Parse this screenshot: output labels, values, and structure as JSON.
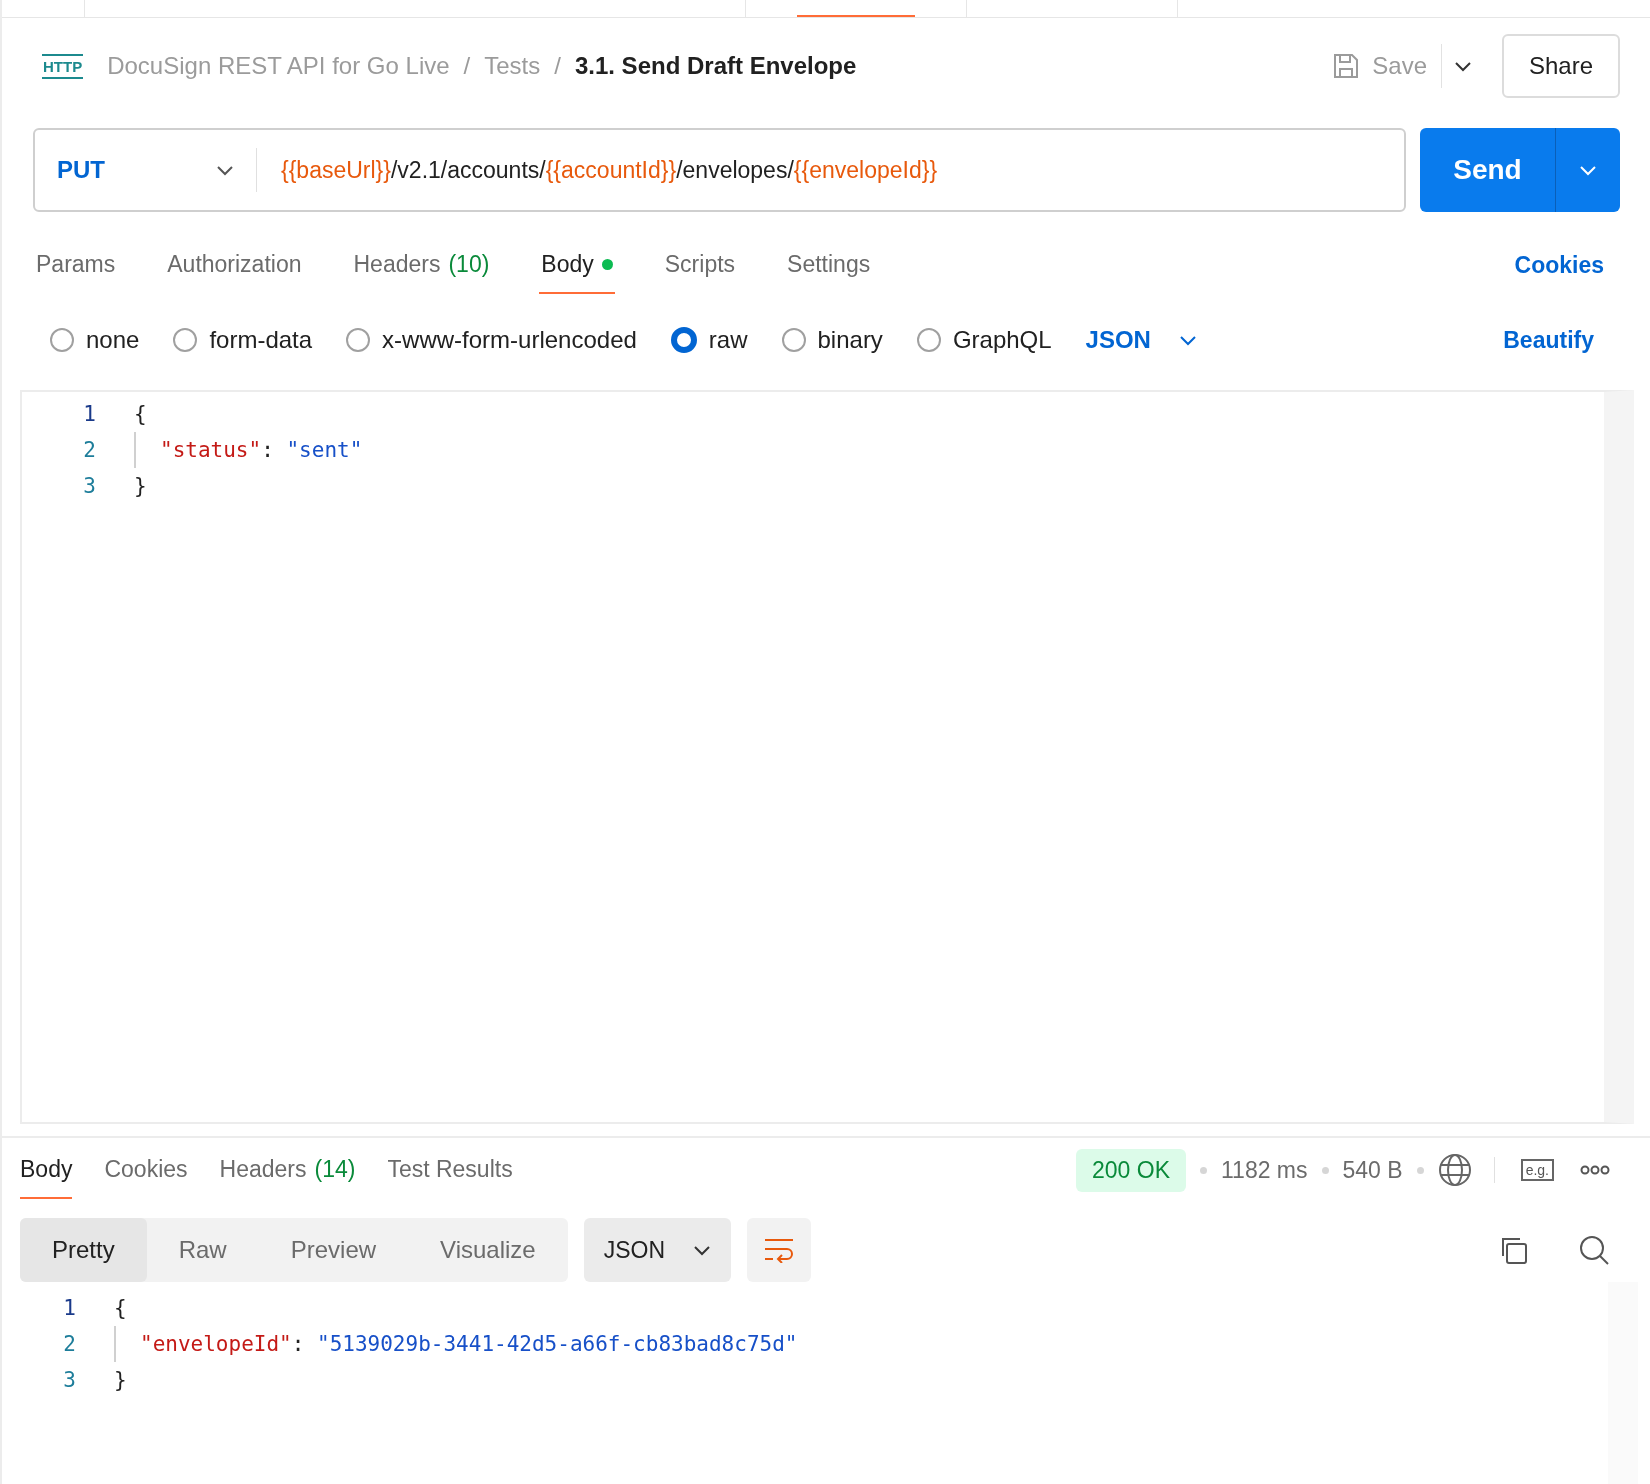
{
  "top_tabs": [
    {
      "selected": false
    },
    {
      "selected": true
    },
    {
      "selected": false
    },
    {
      "selected": false
    }
  ],
  "breadcrumb": {
    "protocol": "HTTP",
    "items": [
      "DocuSign REST API for Go Live",
      "Tests",
      "3.1. Send Draft Envelope"
    ],
    "separator": "/"
  },
  "header_actions": {
    "save": "Save",
    "share": "Share"
  },
  "request": {
    "method": "PUT",
    "url": [
      {
        "kind": "variable",
        "text": "{{baseUrl}}"
      },
      {
        "kind": "text",
        "text": "/v2.1/accounts/"
      },
      {
        "kind": "variable",
        "text": "{{accountId}}"
      },
      {
        "kind": "text",
        "text": "/envelopes/"
      },
      {
        "kind": "variable",
        "text": "{{envelopeId}}"
      }
    ],
    "send": "Send"
  },
  "request_tabs": [
    {
      "label": "Params",
      "selected": false,
      "has_content": false
    },
    {
      "label": "Authorization",
      "selected": false,
      "has_content": false
    },
    {
      "label": "Headers",
      "count": "(10)",
      "selected": false,
      "has_content": false
    },
    {
      "label": "Body",
      "selected": true,
      "has_content": true
    },
    {
      "label": "Scripts",
      "selected": false,
      "has_content": false
    },
    {
      "label": "Settings",
      "selected": false,
      "has_content": false
    }
  ],
  "cookies_link": "Cookies",
  "body_types": [
    {
      "label": "none",
      "selected": false
    },
    {
      "label": "form-data",
      "selected": false
    },
    {
      "label": "x-www-form-urlencoded",
      "selected": false
    },
    {
      "label": "raw",
      "selected": true
    },
    {
      "label": "binary",
      "selected": false
    },
    {
      "label": "GraphQL",
      "selected": false
    }
  ],
  "body_format": "JSON",
  "beautify": "Beautify",
  "request_body": [
    {
      "number": "1",
      "indented": false,
      "tokens": [
        {
          "kind": "punct",
          "text": "{"
        }
      ]
    },
    {
      "number": "2",
      "indented": true,
      "tokens": [
        {
          "kind": "key",
          "text": "\"status\""
        },
        {
          "kind": "punct",
          "text": ": "
        },
        {
          "kind": "string",
          "text": "\"sent\""
        }
      ]
    },
    {
      "number": "3",
      "indented": false,
      "tokens": [
        {
          "kind": "punct",
          "text": "}"
        }
      ]
    }
  ],
  "response_tabs": [
    {
      "label": "Body",
      "selected": true
    },
    {
      "label": "Cookies",
      "selected": false
    },
    {
      "label": "Headers",
      "count": "(14)",
      "selected": false
    },
    {
      "label": "Test Results",
      "selected": false
    }
  ],
  "response_status": {
    "status": "200 OK",
    "time": "1182 ms",
    "size": "540 B",
    "examples": "e.g."
  },
  "view_modes": [
    {
      "label": "Pretty",
      "selected": true
    },
    {
      "label": "Raw",
      "selected": false
    },
    {
      "label": "Preview",
      "selected": false
    },
    {
      "label": "Visualize",
      "selected": false
    }
  ],
  "response_format": "JSON",
  "wrap_lines": true,
  "response_body": [
    {
      "number": "1",
      "indented": false,
      "tokens": [
        {
          "kind": "punct",
          "text": "{"
        }
      ]
    },
    {
      "number": "2",
      "indented": true,
      "tokens": [
        {
          "kind": "key",
          "text": "\"envelopeId\""
        },
        {
          "kind": "punct",
          "text": ": "
        },
        {
          "kind": "string",
          "text": "\"5139029b-3441-42d5-a66f-cb83bad8c75d\""
        }
      ]
    },
    {
      "number": "3",
      "indented": false,
      "tokens": [
        {
          "kind": "punct",
          "text": "}"
        }
      ]
    }
  ]
}
